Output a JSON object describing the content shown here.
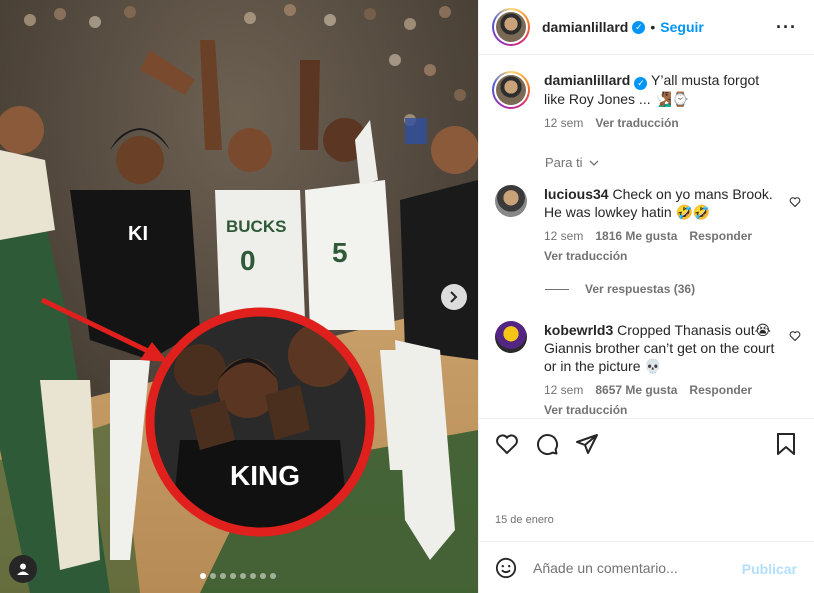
{
  "post": {
    "username": "damianlillard",
    "follow_label": "Seguir",
    "date": "15 de enero"
  },
  "caption": {
    "username": "damianlillard",
    "text": "Y’all musta forgot like Roy Jones ... 🧏🏾‍♂️⌚",
    "time": "12 sem",
    "translate": "Ver traducción"
  },
  "comments_filter": "Para ti",
  "comments": [
    {
      "username": "lucious34",
      "text": "Check on yo mans Brook. He was lowkey hatin 🤣🤣",
      "time": "12 sem",
      "likes": "1816 Me gusta",
      "reply": "Responder",
      "translate": "Ver traducción",
      "replies": "Ver respuestas (36)"
    },
    {
      "username": "kobewrld3",
      "text": "Cropped Thanasis out😭 Giannis brother can’t get on the court or in the picture 💀",
      "time": "12 sem",
      "likes": "8657 Me gusta",
      "reply": "Responder",
      "translate": "Ver traducción"
    }
  ],
  "photo": {
    "jersey_text_1": "BUCKS",
    "jersey_number_1": "0",
    "jersey_number_2": "5",
    "shirt_text": "KING",
    "carousel_count": 8,
    "carousel_active": 1
  },
  "add_comment": {
    "placeholder": "Añade un comentario...",
    "publish": "Publicar"
  },
  "colors": {
    "link": "#0095f6",
    "highlight_circle": "#e0201c",
    "arrow": "#e0201c"
  }
}
